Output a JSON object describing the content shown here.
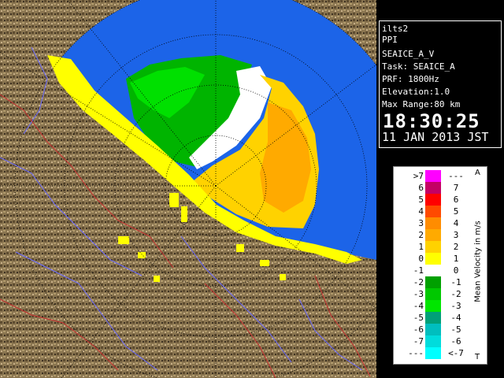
{
  "info": {
    "site": "ilts2",
    "mode": "PPI",
    "product": "SEAICE_A_V",
    "task": "Task: SEAICE_A",
    "prf": "PRF: 1800Hz",
    "elevation": "Elevation:1.0",
    "max_range": "Max Range:80 km",
    "time": "18:30:25",
    "date": "11 JAN 2013 JST"
  },
  "legend": {
    "title": "Mean Velocity in m/s",
    "top_marker": "A",
    "bottom_marker": "T",
    "rows": [
      {
        "left": ">7",
        "right": "---",
        "color": "#ff00ff"
      },
      {
        "left": "6",
        "right": "7",
        "color": "#c40064"
      },
      {
        "left": "5",
        "right": "6",
        "color": "#ff0000"
      },
      {
        "left": "4",
        "right": "5",
        "color": "#ff4a00"
      },
      {
        "left": "3",
        "right": "4",
        "color": "#ff8c00"
      },
      {
        "left": "2",
        "right": "3",
        "color": "#ffaa00"
      },
      {
        "left": "1",
        "right": "2",
        "color": "#ffd200"
      },
      {
        "left": "0",
        "right": "1",
        "color": "#ffff00"
      },
      {
        "left": "-1",
        "right": "0",
        "color": "#ffffff"
      },
      {
        "left": "-2",
        "right": "-1",
        "color": "#00a000"
      },
      {
        "left": "-3",
        "right": "-2",
        "color": "#00c800"
      },
      {
        "left": "-4",
        "right": "-3",
        "color": "#00e600"
      },
      {
        "left": "-5",
        "right": "-4",
        "color": "#00a078"
      },
      {
        "left": "-6",
        "right": "-5",
        "color": "#00bebe"
      },
      {
        "left": "-7",
        "right": "-6",
        "color": "#00dcdc"
      },
      {
        "left": "---",
        "right": "<-7",
        "color": "#00ffff"
      }
    ]
  },
  "colors": {
    "sea": "#1c64e8",
    "land": "#8a7550",
    "range_rings": "#000000"
  }
}
